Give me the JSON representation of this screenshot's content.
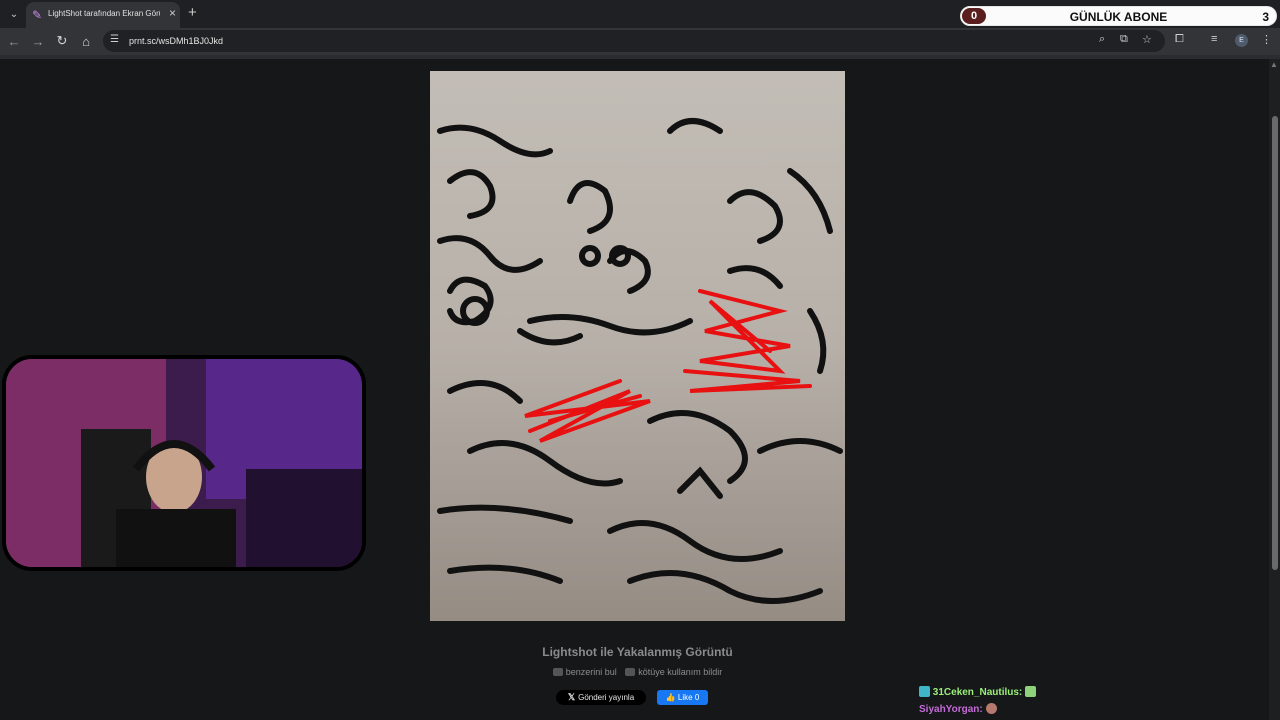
{
  "browser": {
    "tab_title": "LightShot tarafından Ekran Görüntüsü",
    "url": "prnt.sc/wsDMh1BJ0Jkd",
    "profile_initial": "E",
    "new_tab_label": "+"
  },
  "overlay": {
    "abone_label": "GÜNLÜK ABONE",
    "abone_count": "0",
    "abone_goal": "3"
  },
  "page": {
    "caption": "Lightshot ile Yakalanmış Görüntü",
    "similar_link": "benzerini bul",
    "report_link": "kötüye kullanım bildir",
    "share_x_label": "Gönderi yayınla",
    "like_label": "Like",
    "like_count": "0"
  },
  "chat": [
    {
      "user": "31Ceken_Nautilus:",
      "user_color": "#9cf07a"
    },
    {
      "user": "SiyahYorgan:",
      "user_color": "#c46bd8"
    }
  ],
  "icons": [
    "chevron-down-icon",
    "feather-icon",
    "close-icon",
    "back-icon",
    "forward-icon",
    "reload-icon",
    "home-icon",
    "tune-icon",
    "zoom-icon",
    "install-icon",
    "star-icon",
    "extensions-icon",
    "media-icon",
    "menu-icon",
    "x-logo-icon",
    "facebook-like-icon"
  ],
  "colors": {
    "accent_red": "#e81010",
    "chat_green": "#9cf07a",
    "chat_purple": "#c46bd8",
    "facebook_blue": "#1877f2"
  }
}
